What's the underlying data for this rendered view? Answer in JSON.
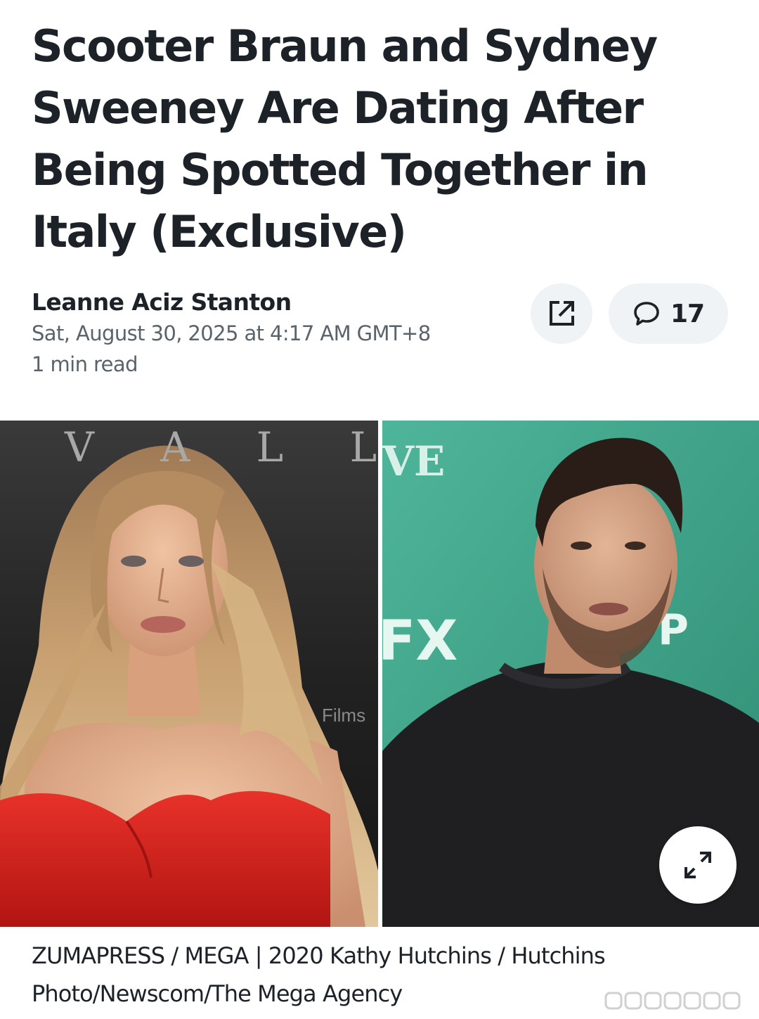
{
  "article": {
    "headline": "Scooter Braun and Sydney Sweeney Are Dating After Being Spotted Together in Italy (Exclusive)",
    "author": "Leanne Aciz Stanton",
    "date": "Sat, August 30, 2025 at 4:17 AM GMT+8",
    "read_time": "1 min read"
  },
  "actions": {
    "share_icon": "share-external-icon",
    "comment_icon": "comment-bubble-icon",
    "comment_count": "17",
    "expand_icon": "expand-arrows-icon"
  },
  "image": {
    "left_backdrop_text": "V A L L E",
    "left_backdrop_small_text": "Films",
    "right_backdrop_text_top": "VE",
    "right_backdrop_logo": "FX",
    "right_backdrop_letter": "P",
    "caption": "ZUMAPRESS / MEGA | 2020 Kathy Hutchins / Hutchins Photo/Newscom/The Mega Agency"
  },
  "colors": {
    "text": "#1d2228",
    "muted": "#5b636a",
    "pill_bg": "#f0f3f5",
    "dress_red": "#d8231f",
    "backdrop_teal": "#3fa489"
  }
}
